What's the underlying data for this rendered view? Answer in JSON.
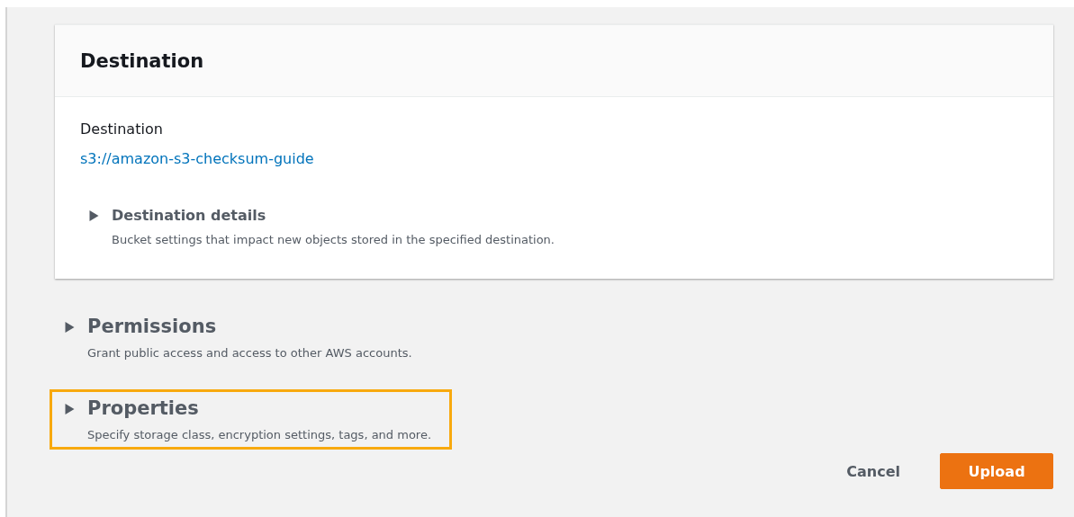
{
  "card": {
    "title": "Destination",
    "field_label": "Destination",
    "field_link": "s3://amazon-s3-checksum-guide",
    "details": {
      "title": "Destination details",
      "description": "Bucket settings that impact new objects stored in the specified destination.",
      "expanded": false
    }
  },
  "sections": [
    {
      "title": "Permissions",
      "description": "Grant public access and access to other AWS accounts.",
      "expanded": false,
      "highlighted": false
    },
    {
      "title": "Properties",
      "description": "Specify storage class, encryption settings, tags, and more.",
      "expanded": false,
      "highlighted": true
    }
  ],
  "buttons": [
    {
      "label": "Cancel",
      "kind": "link"
    },
    {
      "label": "Upload",
      "kind": "primary"
    }
  ]
}
